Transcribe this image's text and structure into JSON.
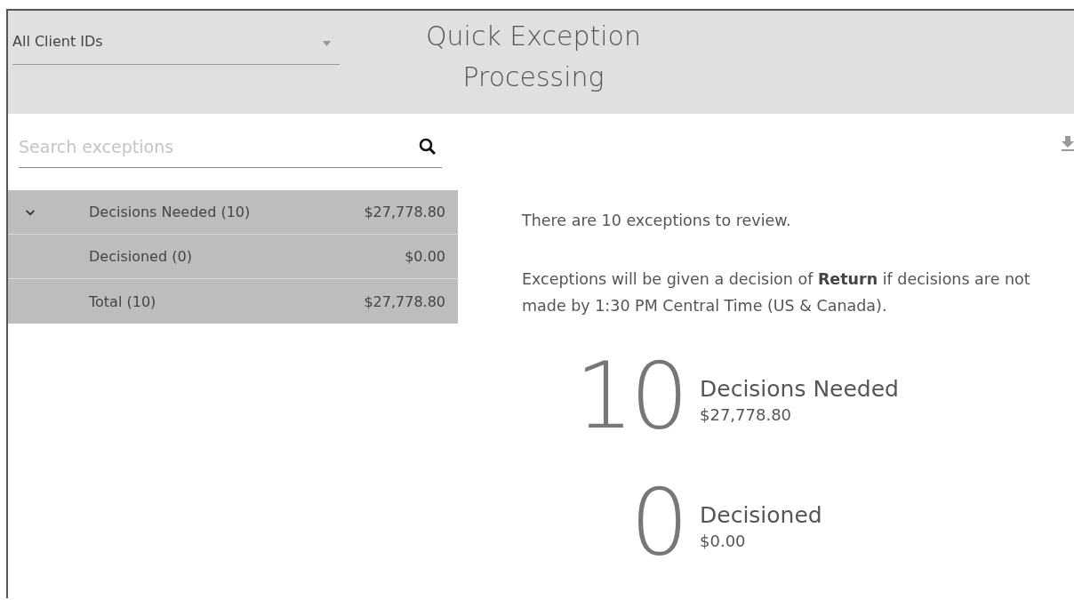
{
  "client_select": {
    "value": "All Client IDs"
  },
  "title": "Quick Exception Processing",
  "search": {
    "placeholder": "Search exceptions"
  },
  "summary_rows": [
    {
      "kind": "group",
      "expanded": true,
      "label": "Decisions Needed (10)",
      "amount": "$27,778.80"
    },
    {
      "kind": "item",
      "label": "Decisioned (0)",
      "amount": "$0.00"
    },
    {
      "kind": "item",
      "label": "Total (10)",
      "amount": "$27,778.80"
    }
  ],
  "messages": [
    "There are 10 exceptions to review.",
    "Exceptions will be given a decision of **Return** if decisions are not made by 1:30 PM Central Time (US & Canada)."
  ],
  "stats": [
    {
      "count": "10",
      "label": "Decisions Needed",
      "amount": "$27,778.80"
    },
    {
      "count": "0",
      "label": "Decisioned",
      "amount": "$0.00"
    }
  ]
}
